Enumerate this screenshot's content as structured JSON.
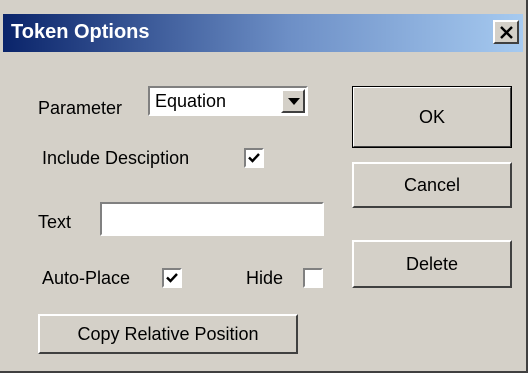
{
  "window": {
    "title": "Token Options"
  },
  "form": {
    "parameter_label": "Parameter",
    "parameter_value": "Equation",
    "include_description_label": "Include Desciption",
    "include_description_checked": true,
    "text_label": "Text",
    "text_value": "",
    "auto_place_label": "Auto-Place",
    "auto_place_checked": true,
    "hide_label": "Hide",
    "hide_checked": false,
    "copy_relative_label": "Copy Relative Position"
  },
  "buttons": {
    "ok": "OK",
    "cancel": "Cancel",
    "delete": "Delete"
  },
  "icons": {
    "close": "close-icon",
    "dropdown": "chevron-down-icon",
    "check": "checkmark-icon"
  }
}
